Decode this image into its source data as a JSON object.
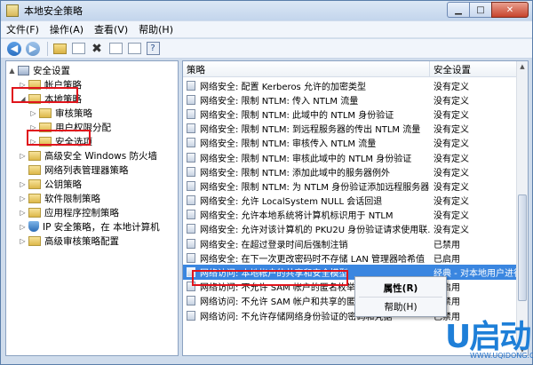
{
  "window": {
    "title": "本地安全策略"
  },
  "menubar": {
    "items": [
      {
        "label": "文件(F)"
      },
      {
        "label": "操作(A)"
      },
      {
        "label": "查看(V)"
      },
      {
        "label": "帮助(H)"
      }
    ]
  },
  "toolbar": {
    "buttons": [
      "back-icon",
      "forward-icon",
      "up-folder-icon",
      "show-hide-tree-icon",
      "delete-icon",
      "properties-icon",
      "export-icon",
      "help-icon"
    ]
  },
  "tree": {
    "items": [
      {
        "label": "安全设置",
        "icon": "computer-icon",
        "twisty": "▲"
      },
      {
        "label": "帐户策略",
        "icon": "folder-icon",
        "twisty": "▷"
      },
      {
        "label": "本地策略",
        "icon": "folder-icon",
        "twisty": "◢"
      },
      {
        "label": "审核策略",
        "icon": "folder-icon",
        "twisty": "▷"
      },
      {
        "label": "用户权限分配",
        "icon": "folder-icon",
        "twisty": "▷"
      },
      {
        "label": "安全选项",
        "icon": "folder-icon",
        "twisty": "▷"
      },
      {
        "label": "高级安全 Windows 防火墙",
        "icon": "folder-icon",
        "twisty": "▷"
      },
      {
        "label": "网络列表管理器策略",
        "icon": "folder-icon",
        "twisty": ""
      },
      {
        "label": "公钥策略",
        "icon": "folder-icon",
        "twisty": "▷"
      },
      {
        "label": "软件限制策略",
        "icon": "folder-icon",
        "twisty": "▷"
      },
      {
        "label": "应用程序控制策略",
        "icon": "folder-icon",
        "twisty": "▷"
      },
      {
        "label": "IP 安全策略，在 本地计算机",
        "icon": "shield-icon",
        "twisty": "▷"
      },
      {
        "label": "高级审核策略配置",
        "icon": "folder-icon",
        "twisty": "▷"
      }
    ]
  },
  "list": {
    "columns": {
      "policy": "策略",
      "setting": "安全设置"
    },
    "rows": [
      {
        "policy": "网络安全: 配置 Kerberos 允许的加密类型",
        "setting": "没有定义"
      },
      {
        "policy": "网络安全: 限制 NTLM: 传入 NTLM 流量",
        "setting": "没有定义"
      },
      {
        "policy": "网络安全: 限制 NTLM: 此域中的 NTLM 身份验证",
        "setting": "没有定义"
      },
      {
        "policy": "网络安全: 限制 NTLM: 到远程服务器的传出 NTLM 流量",
        "setting": "没有定义"
      },
      {
        "policy": "网络安全: 限制 NTLM: 审核传入 NTLM 流量",
        "setting": "没有定义"
      },
      {
        "policy": "网络安全: 限制 NTLM: 审核此域中的 NTLM 身份验证",
        "setting": "没有定义"
      },
      {
        "policy": "网络安全: 限制 NTLM: 添加此域中的服务器例外",
        "setting": "没有定义"
      },
      {
        "policy": "网络安全: 限制 NTLM: 为 NTLM 身份验证添加远程服务器...",
        "setting": "没有定义"
      },
      {
        "policy": "网络安全: 允许 LocalSystem NULL 会话回退",
        "setting": "没有定义"
      },
      {
        "policy": "网络安全: 允许本地系统将计算机标识用于 NTLM",
        "setting": "没有定义"
      },
      {
        "policy": "网络安全: 允许对该计算机的 PKU2U 身份验证请求使用联...",
        "setting": "没有定义"
      },
      {
        "policy": "网络安全: 在超过登录时间后强制注销",
        "setting": "已禁用"
      },
      {
        "policy": "网络安全: 在下一次更改密码时不存储 LAN 管理器哈希值",
        "setting": "已启用"
      },
      {
        "policy": "网络访问: 本地帐户的共享和安全模型",
        "setting": "经典 - 对本地用户进行"
      },
      {
        "policy": "网络访问: 不允许 SAM 帐户的匿名枚举",
        "setting": "已启用"
      },
      {
        "policy": "网络访问: 不允许 SAM 帐户和共享的匿名枚举",
        "setting": "已禁用"
      },
      {
        "policy": "网络访问: 不允许存储网络身份验证的密码和凭据",
        "setting": "已禁用"
      }
    ],
    "selected_row": 13
  },
  "context_menu": {
    "properties": "属性(R)",
    "help": "帮助(H)"
  },
  "watermark": {
    "logo_text": "U启动",
    "url": "WWW.UQIDONG.COM"
  },
  "colors": {
    "highlight": "#e0141c",
    "selection": "#3a86e0",
    "logo": "#1e7fd8"
  }
}
